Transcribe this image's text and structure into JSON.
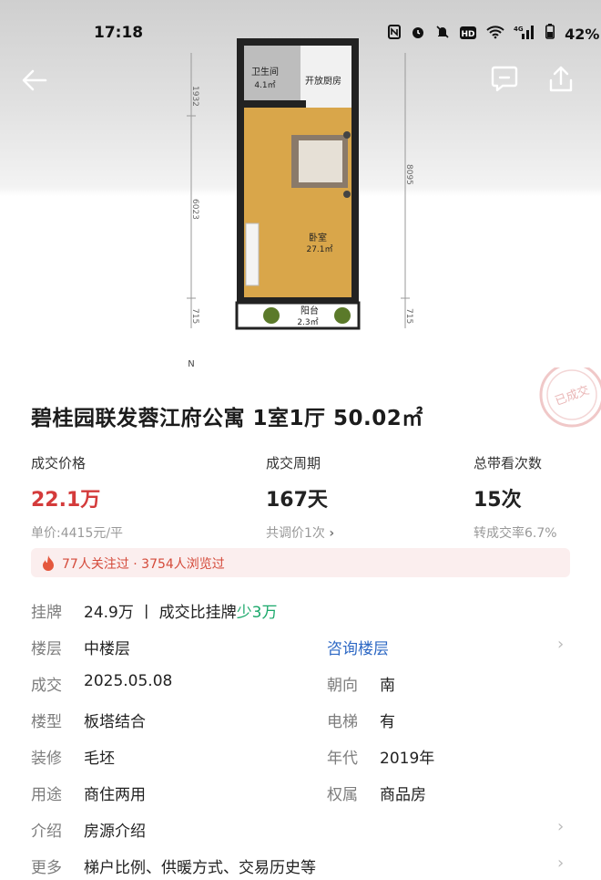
{
  "status_bar": {
    "time": "17:18",
    "network": "4G",
    "battery": "42%",
    "icons": [
      "nfc-icon",
      "alarm-icon",
      "mute-icon",
      "hd-icon",
      "wifi-icon",
      "signal-icon",
      "battery-icon"
    ]
  },
  "floorplan": {
    "rooms": [
      {
        "name": "卫生间",
        "area": "4.1㎡"
      },
      {
        "name": "开放厨房",
        "area": ""
      },
      {
        "name": "卧室",
        "area": "27.1㎡"
      },
      {
        "name": "阳台",
        "area": "2.3㎡"
      }
    ],
    "dimensions": {
      "left_top": "1932",
      "left_mid": "6023",
      "left_bottom": "715",
      "right_main": "8095",
      "right_bottom": "715"
    },
    "compass": "N"
  },
  "stamp_text": "已成交",
  "title": "碧桂园联发蓉江府公寓 1室1厅 50.02㎡",
  "stats": {
    "price": {
      "label": "成交价格",
      "value": "22.1万",
      "sub": "单价:4415元/平"
    },
    "cycle": {
      "label": "成交周期",
      "value": "167天",
      "sub": "共调价1次"
    },
    "views": {
      "label": "总带看次数",
      "value": "15次",
      "sub": "转成交率6.7%"
    }
  },
  "heat": "77人关注过 · 3754人浏览过",
  "listing": {
    "label": "挂牌",
    "value": "24.9万",
    "separator": "丨",
    "compare": "成交比挂牌",
    "diff": "少3万"
  },
  "details": {
    "floor": {
      "label": "楼层",
      "value": "中楼层",
      "link": "咨询楼层"
    },
    "deal": {
      "label": "成交",
      "value": "2025.05.08"
    },
    "orientation": {
      "label": "朝向",
      "value": "南"
    },
    "building_type": {
      "label": "楼型",
      "value": "板塔结合"
    },
    "elevator": {
      "label": "电梯",
      "value": "有"
    },
    "decoration": {
      "label": "装修",
      "value": "毛坯"
    },
    "year": {
      "label": "年代",
      "value": "2019年"
    },
    "usage": {
      "label": "用途",
      "value": "商住两用"
    },
    "ownership": {
      "label": "权属",
      "value": "商品房"
    },
    "intro": {
      "label": "介绍",
      "value": "房源介绍"
    },
    "more": {
      "label": "更多",
      "value": "梯户比例、供暖方式、交易历史等"
    }
  },
  "colors": {
    "accent_red": "#d43b3b",
    "green": "#1aa86a",
    "blue": "#2d68c4"
  }
}
